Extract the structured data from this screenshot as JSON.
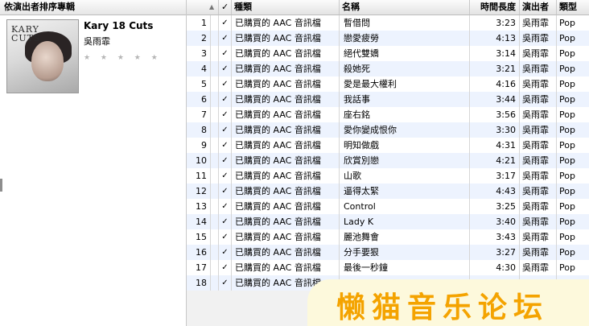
{
  "browser": {
    "header": "依演出者排序專輯",
    "album": {
      "title": "Kary 18 Cuts",
      "artist": "吳雨霏",
      "rating": "★ ★ ★ ★ ★"
    }
  },
  "columns": {
    "num": "",
    "check": "✓",
    "kind": "種類",
    "name": "名稱",
    "time": "時間長度",
    "artist": "演出者",
    "genre": "類型"
  },
  "tracks": [
    {
      "num": "1",
      "check": "✓",
      "kind": "已購買的 AAC 音訊檔",
      "name": "暫借問",
      "time": "3:23",
      "artist": "吳雨霏",
      "genre": "Pop"
    },
    {
      "num": "2",
      "check": "✓",
      "kind": "已購買的 AAC 音訊檔",
      "name": "戀愛疲勞",
      "time": "4:13",
      "artist": "吳雨霏",
      "genre": "Pop"
    },
    {
      "num": "3",
      "check": "✓",
      "kind": "已購買的 AAC 音訊檔",
      "name": "絕代雙嬌",
      "time": "3:14",
      "artist": "吳雨霏",
      "genre": "Pop"
    },
    {
      "num": "4",
      "check": "✓",
      "kind": "已購買的 AAC 音訊檔",
      "name": "殺她死",
      "time": "3:21",
      "artist": "吳雨霏",
      "genre": "Pop"
    },
    {
      "num": "5",
      "check": "✓",
      "kind": "已購買的 AAC 音訊檔",
      "name": "愛是最大權利",
      "time": "4:16",
      "artist": "吳雨霏",
      "genre": "Pop"
    },
    {
      "num": "6",
      "check": "✓",
      "kind": "已購買的 AAC 音訊檔",
      "name": "我話事",
      "time": "3:44",
      "artist": "吳雨霏",
      "genre": "Pop"
    },
    {
      "num": "7",
      "check": "✓",
      "kind": "已購買的 AAC 音訊檔",
      "name": "座右銘",
      "time": "3:56",
      "artist": "吳雨霏",
      "genre": "Pop"
    },
    {
      "num": "8",
      "check": "✓",
      "kind": "已購買的 AAC 音訊檔",
      "name": "愛你變成恨你",
      "time": "3:30",
      "artist": "吳雨霏",
      "genre": "Pop"
    },
    {
      "num": "9",
      "check": "✓",
      "kind": "已購買的 AAC 音訊檔",
      "name": "明知做戲",
      "time": "4:31",
      "artist": "吳雨霏",
      "genre": "Pop"
    },
    {
      "num": "10",
      "check": "✓",
      "kind": "已購買的 AAC 音訊檔",
      "name": "欣賞別戀",
      "time": "4:21",
      "artist": "吳雨霏",
      "genre": "Pop"
    },
    {
      "num": "11",
      "check": "✓",
      "kind": "已購買的 AAC 音訊檔",
      "name": "山歌",
      "time": "3:17",
      "artist": "吳雨霏",
      "genre": "Pop"
    },
    {
      "num": "12",
      "check": "✓",
      "kind": "已購買的 AAC 音訊檔",
      "name": "逼得太緊",
      "time": "4:43",
      "artist": "吳雨霏",
      "genre": "Pop"
    },
    {
      "num": "13",
      "check": "✓",
      "kind": "已購買的 AAC 音訊檔",
      "name": "Control",
      "time": "3:25",
      "artist": "吳雨霏",
      "genre": "Pop"
    },
    {
      "num": "14",
      "check": "✓",
      "kind": "已購買的 AAC 音訊檔",
      "name": "Lady K",
      "time": "3:40",
      "artist": "吳雨霏",
      "genre": "Pop"
    },
    {
      "num": "15",
      "check": "✓",
      "kind": "已購買的 AAC 音訊檔",
      "name": "麗池舞會",
      "time": "3:43",
      "artist": "吳雨霏",
      "genre": "Pop"
    },
    {
      "num": "16",
      "check": "✓",
      "kind": "已購買的 AAC 音訊檔",
      "name": "分手要狠",
      "time": "3:27",
      "artist": "吳雨霏",
      "genre": "Pop"
    },
    {
      "num": "17",
      "check": "✓",
      "kind": "已購買的 AAC 音訊檔",
      "name": "最後一秒鐘",
      "time": "4:30",
      "artist": "吳雨霏",
      "genre": "Pop"
    },
    {
      "num": "18",
      "check": "✓",
      "kind": "已購買的 AAC 音訊檔",
      "name": "",
      "time": "",
      "artist": "",
      "genre": ""
    }
  ],
  "watermark": "懒猫音乐论坛",
  "colors": {
    "row_alt": "#edf3fe",
    "watermark": "#f4a300"
  }
}
